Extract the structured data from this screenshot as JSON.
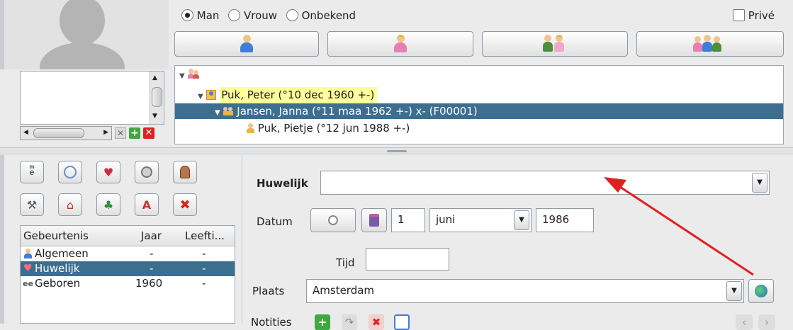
{
  "gender": {
    "options": [
      "Man",
      "Vrouw",
      "Onbekend"
    ],
    "selected": "Man",
    "prive_label": "Privé"
  },
  "tree": {
    "rows": [
      {
        "text": ""
      },
      {
        "text": "Puk, Peter (°10 dec 1960 +-)"
      },
      {
        "text": "Jansen, Janna (°11 maa 1962 +-) x- (F00001)"
      },
      {
        "text": "Puk, Pietje (°12 jun 1988 +-)"
      }
    ]
  },
  "events": {
    "headers": [
      "Gebeurtenis",
      "Jaar",
      "Leefti..."
    ],
    "rows": [
      {
        "name": "Algemeen",
        "year": "-",
        "age": "-"
      },
      {
        "name": "Huwelijk",
        "year": "-",
        "age": "-"
      },
      {
        "name": "Geboren",
        "year": "1960",
        "age": "-"
      }
    ],
    "selected_index": 1
  },
  "form": {
    "event_type_label": "Huwelijk",
    "event_type_value": "",
    "date_label": "Datum",
    "date_day": "1",
    "date_month": "juni",
    "date_year": "1986",
    "time_label": "Tijd",
    "time_value": "",
    "place_label": "Plaats",
    "place_value": "Amsterdam",
    "notes_label": "Notities"
  },
  "colors": {
    "selection": "#3d6e8f",
    "highlight": "#ffff99",
    "arrow": "#e02020"
  }
}
